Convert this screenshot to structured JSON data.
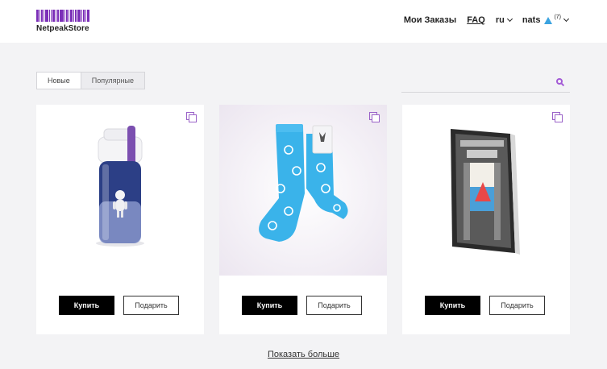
{
  "brand": {
    "name": "NetpeakStore",
    "color": "#7b2fb8"
  },
  "nav": {
    "orders": "Мои Заказы",
    "faq": "FAQ",
    "lang": "ru",
    "user": "nats",
    "user_count": "(7)"
  },
  "tabs": [
    {
      "label": "Новые",
      "active": true
    },
    {
      "label": "Популярные",
      "active": false
    }
  ],
  "search": {
    "placeholder": "",
    "icon": "search-icon"
  },
  "products": [
    {
      "image": "bottle",
      "buy_label": "Купить",
      "gift_label": "Подарить"
    },
    {
      "image": "socks",
      "buy_label": "Купить",
      "gift_label": "Подарить"
    },
    {
      "image": "book",
      "buy_label": "Купить",
      "gift_label": "Подарить"
    }
  ],
  "show_more": "Показать больше"
}
